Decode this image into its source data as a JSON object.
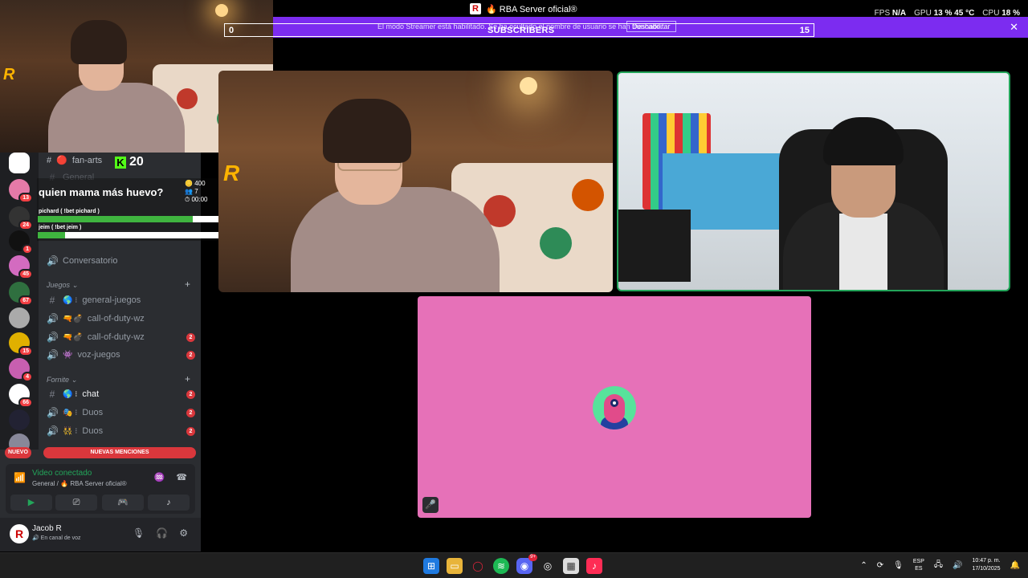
{
  "window": {
    "title": "🔥 RBA Server oficial®",
    "stats": {
      "fps_label": "FPS",
      "fps_value": "N/A",
      "gpu_label": "GPU",
      "gpu_value": "13 % 45 °C",
      "cpu_label": "CPU",
      "cpu_value": "18 %"
    }
  },
  "banner": {
    "message": "El modo Streamer está habilitado. Se ha ocultado el nombre de usuario se han truncado.",
    "disable_label": "Deshabilitar",
    "close_glyph": "✕",
    "color": "#7c2cf0"
  },
  "subscribers": {
    "start": "0",
    "label": "SUBSCRIBERS",
    "goal": "15"
  },
  "overlay": {
    "fan_arts": "fan-arts",
    "kick_count": "20",
    "logo_glyph": "R",
    "poll": {
      "question": "quien mama más huevo?",
      "points": "400",
      "votes": "7",
      "timer": "00:00",
      "options": [
        {
          "label": "pichard ( !bet pichard )",
          "share": 0.85
        },
        {
          "label": "jeim ( !bet jeim )",
          "share": 0.15
        }
      ]
    }
  },
  "servers": {
    "badges": [
      "13",
      "24",
      "1",
      "45",
      "67",
      "15",
      "4",
      "66"
    ]
  },
  "channels": {
    "general_stub": "General",
    "conversatorio": "Conversatorio",
    "categories": [
      {
        "name": "Juegos",
        "chevron": "⌄"
      },
      {
        "name": "Fornite",
        "chevron": "⌄"
      }
    ],
    "juegos": [
      {
        "name": "general-juegos",
        "emoji": "🌎 ⁝",
        "badge": ""
      },
      {
        "name": "call-of-duty-wz",
        "emoji": "🔫💣",
        "badge": ""
      },
      {
        "name": "call-of-duty-wz",
        "emoji": "🔫💣",
        "badge": "2"
      },
      {
        "name": "voz-juegos",
        "emoji": "👾",
        "badge": "2"
      }
    ],
    "fornite": [
      {
        "name": "chat",
        "emoji": "🌎 ⁝",
        "badge": "2"
      },
      {
        "name": "Duos",
        "emoji": "🎭 ⁝",
        "badge": "2"
      },
      {
        "name": "Duos",
        "emoji": "👯 ⁝",
        "badge": "2"
      }
    ]
  },
  "mentions": {
    "new_label": "NUEVO",
    "mentions_label": "NUEVAS MENCIONES"
  },
  "voice": {
    "status": "Video conectado",
    "location": "General / 🔥 RBA Server oficial®"
  },
  "user": {
    "name": "Jacob R",
    "status": "🔊 En canal de voz",
    "avatar_glyph": "R"
  },
  "taskbar": {
    "lang_top": "ESP",
    "lang_bottom": "ES",
    "time": "10:47 p. m.",
    "date": "17/10/2025",
    "discord_badge": "9+"
  }
}
